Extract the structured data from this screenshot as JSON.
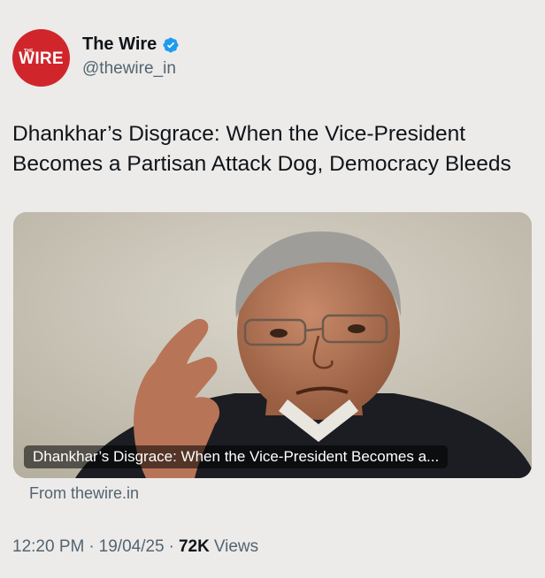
{
  "account": {
    "avatar_small_text": "THE",
    "avatar_text": "WIRE",
    "display_name": "The Wire",
    "handle": "@thewire_in",
    "verified": true,
    "brand_color": "#d0262b",
    "verified_color": "#1d9bf0"
  },
  "tweet": {
    "text": "Dhankhar’s Disgrace: When the Vice-President Becomes a Partisan Attack Dog, Democracy Bleeds"
  },
  "card": {
    "title": "Dhankhar’s Disgrace: When the Vice-President Becomes a...",
    "source": "From thewire.in",
    "image_icon": "photo-of-speaker-gesturing"
  },
  "meta": {
    "time": "12:20 PM",
    "separator": "·",
    "date": "19/04/25",
    "views_count": "72K",
    "views_label": "Views"
  }
}
